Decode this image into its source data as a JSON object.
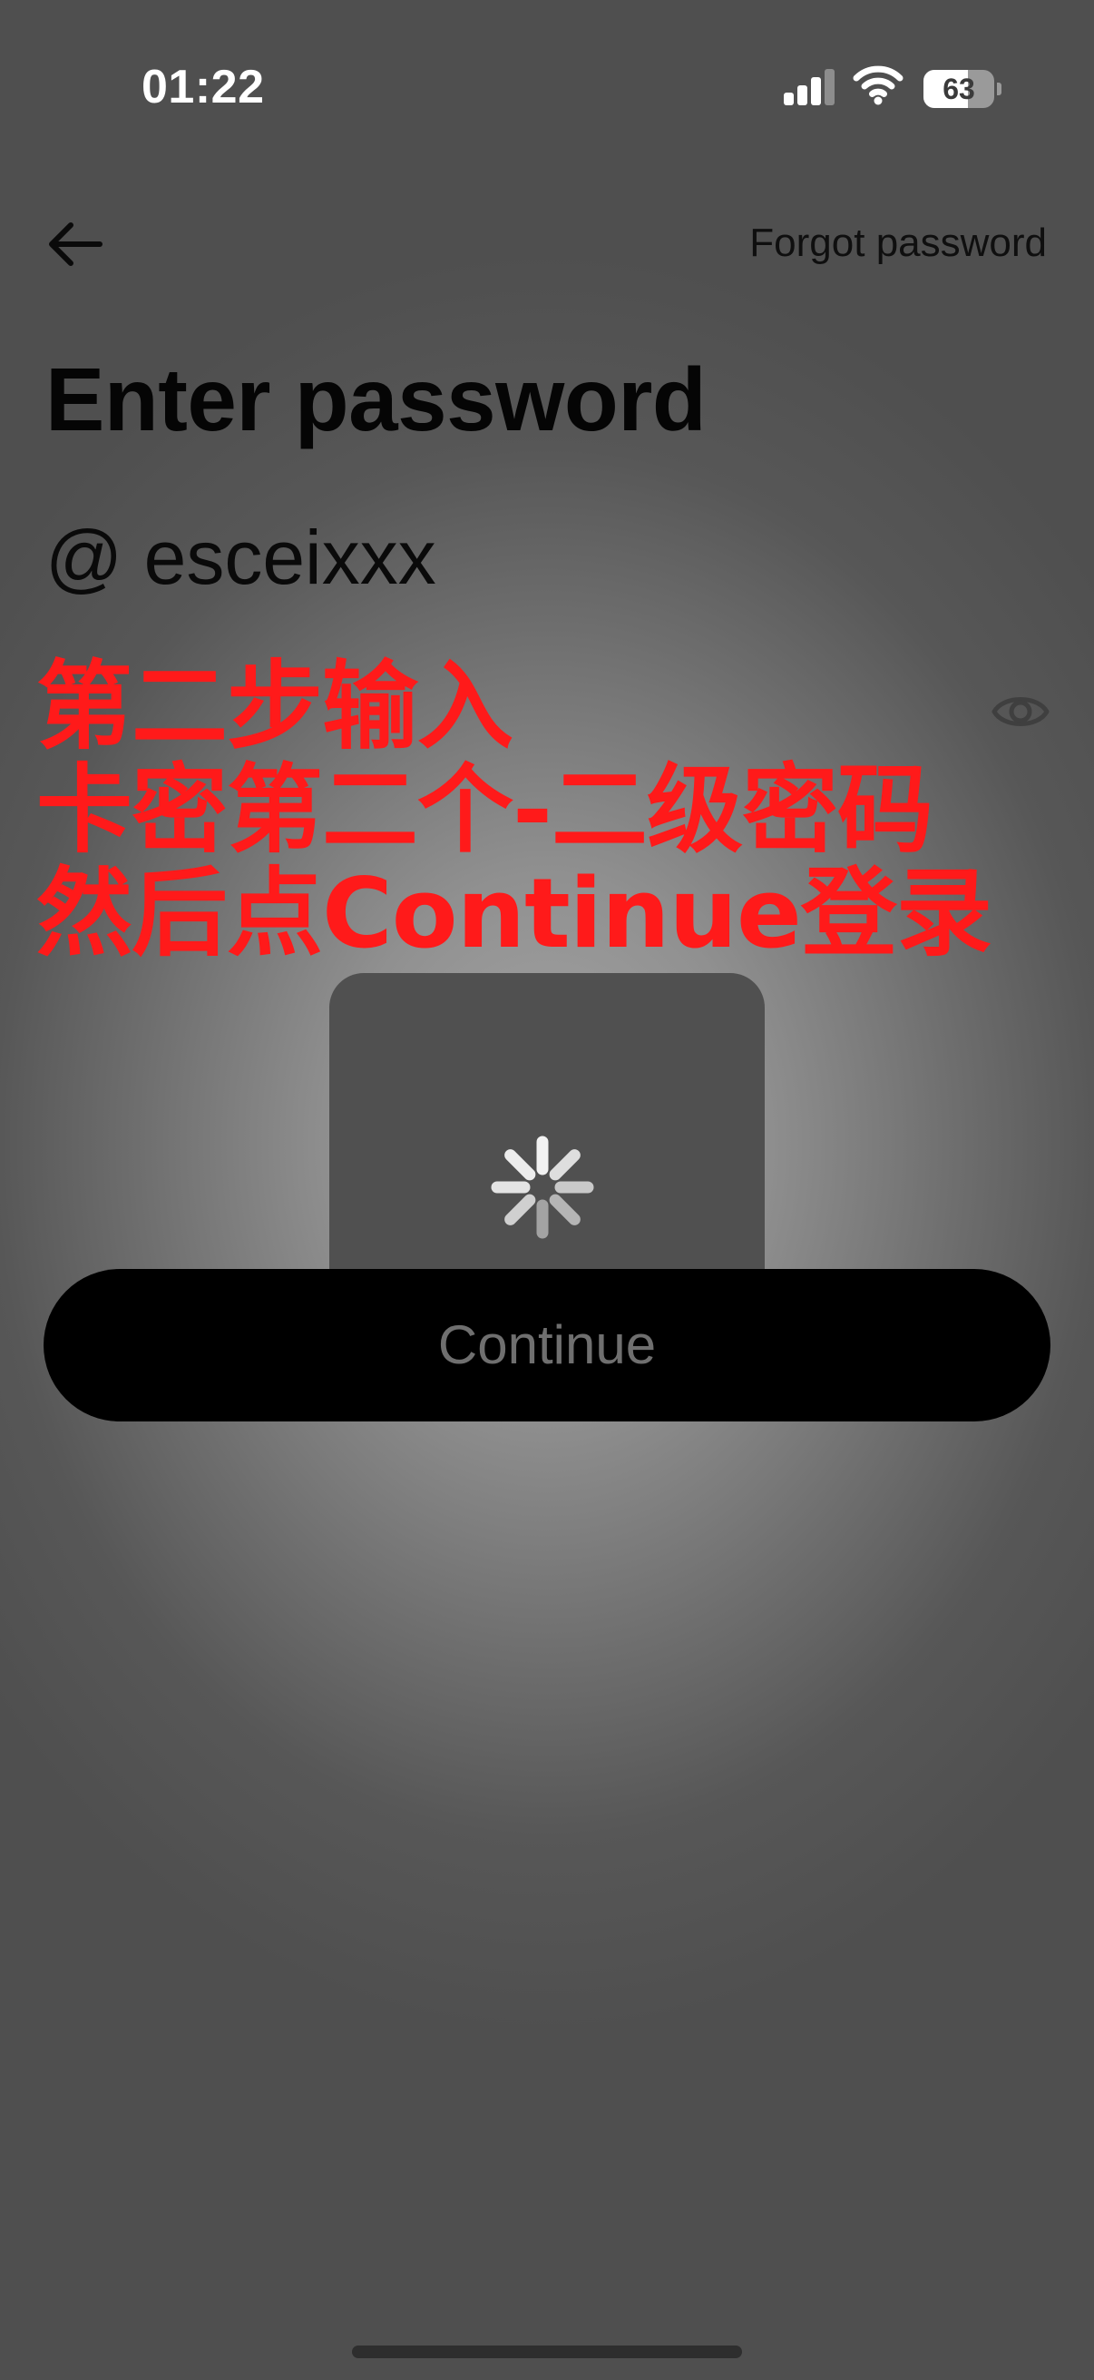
{
  "status_bar": {
    "time": "01:22",
    "battery_level": "63",
    "battery_fraction": 0.63,
    "icons": [
      "signal-icon",
      "wifi-icon",
      "battery-icon"
    ]
  },
  "header": {
    "back_icon": "arrow-left-icon",
    "forgot_password_label": "Forgot password"
  },
  "main": {
    "title": "Enter password",
    "username": "@ esceixxx",
    "password_visibility_icon": "eye-icon"
  },
  "annotation": {
    "lines": [
      "第二步输入",
      "卡密第二个-二级密码",
      "然后点Continue登录"
    ],
    "color": "#ff1a1a"
  },
  "loading": {
    "icon": "spinner-icon"
  },
  "continue_button": {
    "label": "Continue"
  }
}
